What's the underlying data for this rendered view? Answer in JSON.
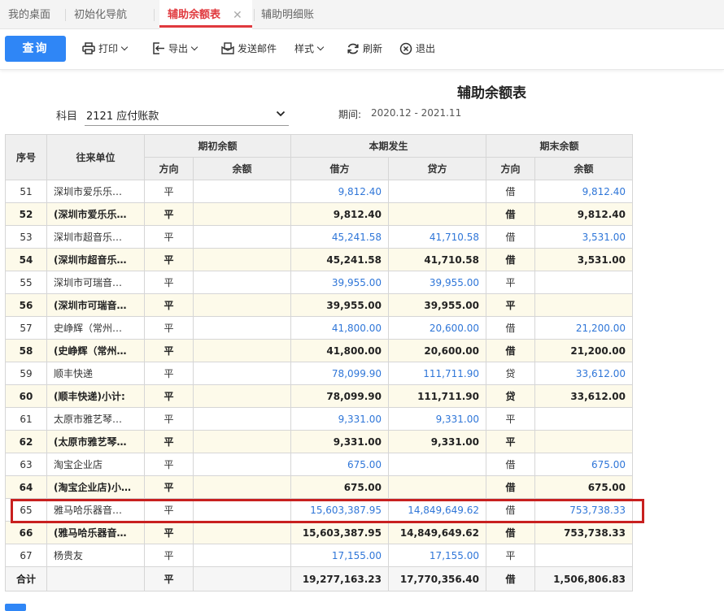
{
  "tabs": [
    {
      "label": "我的桌面"
    },
    {
      "label": "初始化导航"
    },
    {
      "label": "辅助余额表"
    },
    {
      "label": "辅助明细账"
    }
  ],
  "toolbar": {
    "query": "查询",
    "print": "打印",
    "export": "导出",
    "email": "发送邮件",
    "style": "样式",
    "refresh": "刷新",
    "exit": "退出"
  },
  "report": {
    "title": "辅助余额表",
    "subject_label": "科目",
    "subject_value": "2121 应付账款",
    "period_label": "期间:",
    "period_value": "2020.12 - 2021.11"
  },
  "table": {
    "headers": {
      "seq": "序号",
      "unit": "往来单位",
      "opening": "期初余额",
      "current": "本期发生",
      "closing": "期末余额",
      "direction": "方向",
      "balance": "余额",
      "debit": "借方",
      "credit": "贷方"
    },
    "rows": [
      {
        "seq": "51",
        "unit": "深圳市爱乐乐…",
        "od": "平",
        "ob": "",
        "debit": "9,812.40",
        "credit": "",
        "cd": "借",
        "cb": "9,812.40",
        "kind": "detail"
      },
      {
        "seq": "52",
        "unit": "(深圳市爱乐乐…",
        "od": "平",
        "ob": "",
        "debit": "9,812.40",
        "credit": "",
        "cd": "借",
        "cb": "9,812.40",
        "kind": "sub"
      },
      {
        "seq": "53",
        "unit": "深圳市超音乐…",
        "od": "平",
        "ob": "",
        "debit": "45,241.58",
        "credit": "41,710.58",
        "cd": "借",
        "cb": "3,531.00",
        "kind": "detail"
      },
      {
        "seq": "54",
        "unit": "(深圳市超音乐…",
        "od": "平",
        "ob": "",
        "debit": "45,241.58",
        "credit": "41,710.58",
        "cd": "借",
        "cb": "3,531.00",
        "kind": "sub"
      },
      {
        "seq": "55",
        "unit": "深圳市可瑞音…",
        "od": "平",
        "ob": "",
        "debit": "39,955.00",
        "credit": "39,955.00",
        "cd": "平",
        "cb": "",
        "kind": "detail"
      },
      {
        "seq": "56",
        "unit": "(深圳市可瑞音…",
        "od": "平",
        "ob": "",
        "debit": "39,955.00",
        "credit": "39,955.00",
        "cd": "平",
        "cb": "",
        "kind": "sub"
      },
      {
        "seq": "57",
        "unit": "史峥辉（常州…",
        "od": "平",
        "ob": "",
        "debit": "41,800.00",
        "credit": "20,600.00",
        "cd": "借",
        "cb": "21,200.00",
        "kind": "detail"
      },
      {
        "seq": "58",
        "unit": "(史峥辉（常州…",
        "od": "平",
        "ob": "",
        "debit": "41,800.00",
        "credit": "20,600.00",
        "cd": "借",
        "cb": "21,200.00",
        "kind": "sub"
      },
      {
        "seq": "59",
        "unit": "顺丰快递",
        "od": "平",
        "ob": "",
        "debit": "78,099.90",
        "credit": "111,711.90",
        "cd": "贷",
        "cb": "33,612.00",
        "kind": "detail"
      },
      {
        "seq": "60",
        "unit": "(顺丰快递)小计:",
        "od": "平",
        "ob": "",
        "debit": "78,099.90",
        "credit": "111,711.90",
        "cd": "贷",
        "cb": "33,612.00",
        "kind": "sub"
      },
      {
        "seq": "61",
        "unit": "太原市雅艺琴…",
        "od": "平",
        "ob": "",
        "debit": "9,331.00",
        "credit": "9,331.00",
        "cd": "平",
        "cb": "",
        "kind": "detail"
      },
      {
        "seq": "62",
        "unit": "(太原市雅艺琴…",
        "od": "平",
        "ob": "",
        "debit": "9,331.00",
        "credit": "9,331.00",
        "cd": "平",
        "cb": "",
        "kind": "sub"
      },
      {
        "seq": "63",
        "unit": "淘宝企业店",
        "od": "平",
        "ob": "",
        "debit": "675.00",
        "credit": "",
        "cd": "借",
        "cb": "675.00",
        "kind": "detail"
      },
      {
        "seq": "64",
        "unit": "(淘宝企业店)小…",
        "od": "平",
        "ob": "",
        "debit": "675.00",
        "credit": "",
        "cd": "借",
        "cb": "675.00",
        "kind": "sub"
      },
      {
        "seq": "65",
        "unit": "雅马哈乐器音…",
        "od": "平",
        "ob": "",
        "debit": "15,603,387.95",
        "credit": "14,849,649.62",
        "cd": "借",
        "cb": "753,738.33",
        "kind": "detail"
      },
      {
        "seq": "66",
        "unit": "(雅马哈乐器音…",
        "od": "平",
        "ob": "",
        "debit": "15,603,387.95",
        "credit": "14,849,649.62",
        "cd": "借",
        "cb": "753,738.33",
        "kind": "sub"
      },
      {
        "seq": "67",
        "unit": "杨贵友",
        "od": "平",
        "ob": "",
        "debit": "17,155.00",
        "credit": "17,155.00",
        "cd": "平",
        "cb": "",
        "kind": "detail"
      }
    ],
    "total": {
      "seq": "合计",
      "unit": "",
      "od": "平",
      "ob": "",
      "debit": "19,277,163.23",
      "credit": "17,770,356.40",
      "cd": "借",
      "cb": "1,506,806.83"
    }
  },
  "colors": {
    "accent": "#2f86f6",
    "active_tab": "#e0393e",
    "highlight_box": "#c8201f",
    "link_number": "#2f76d8",
    "subtotal_bg": "#fdfaea"
  },
  "icons": [
    "print-icon",
    "export-icon",
    "email-icon",
    "refresh-icon",
    "exit-icon",
    "close-icon",
    "chevron-down-icon"
  ]
}
